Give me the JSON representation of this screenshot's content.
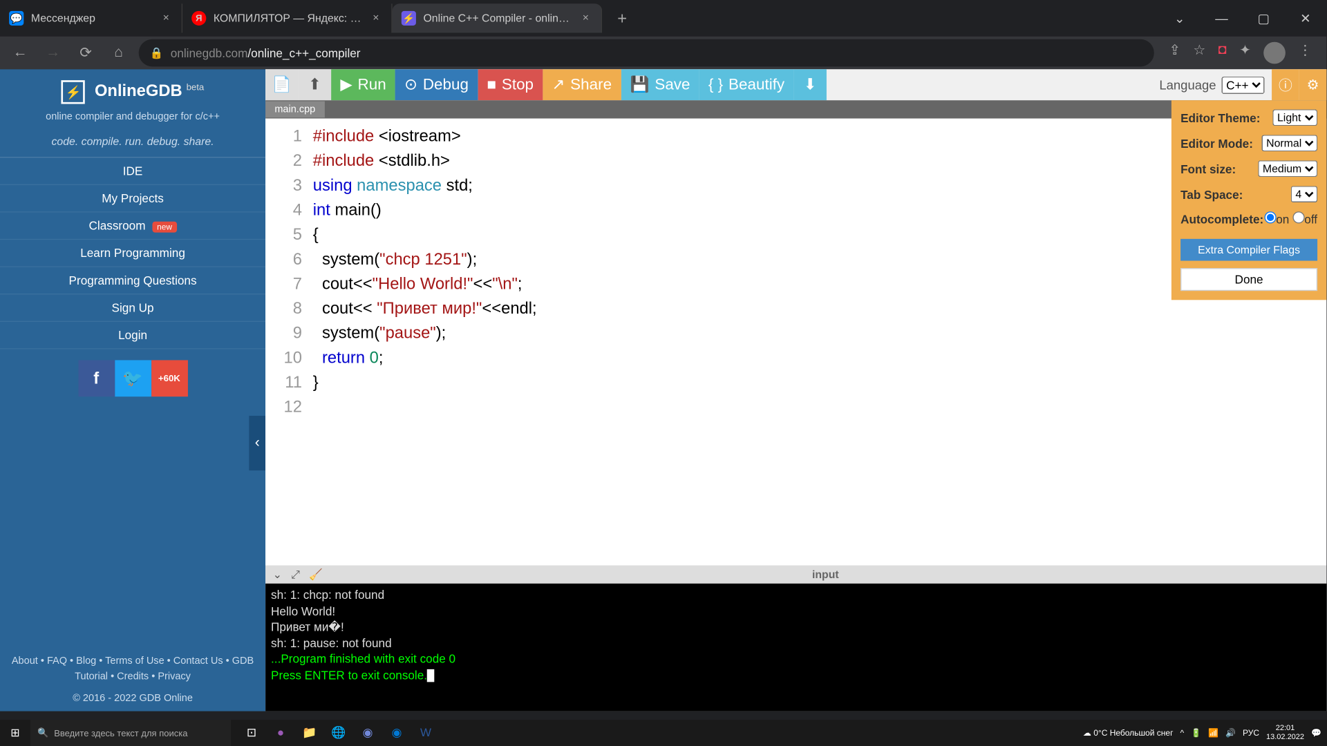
{
  "browser": {
    "tabs": [
      {
        "favicon": "💬",
        "title": "Мессенджер",
        "active": false
      },
      {
        "favicon": "Я",
        "title": "КОМПИЛЯТОР — Яндекс: нашл",
        "active": false
      },
      {
        "favicon": "⚡",
        "title": "Online C++ Compiler - online ed",
        "active": true
      }
    ],
    "url_host": "onlinegdb.com",
    "url_path": "/online_c++_compiler"
  },
  "sidebar": {
    "title": "OnlineGDB",
    "beta": "beta",
    "subtitle": "online compiler and debugger for c/c++",
    "slogan": "code. compile. run. debug. share.",
    "items": [
      "IDE",
      "My Projects",
      "Classroom",
      "Learn Programming",
      "Programming Questions",
      "Sign Up",
      "Login"
    ],
    "new_badge": "new",
    "social_count": "60K",
    "footer": "About • FAQ • Blog • Terms of Use • Contact Us • GDB Tutorial • Credits • Privacy",
    "copyright": "© 2016 - 2022 GDB Online"
  },
  "toolbar": {
    "run": "Run",
    "debug": "Debug",
    "stop": "Stop",
    "share": "Share",
    "save": "Save",
    "beautify": "Beautify",
    "lang_label": "Language",
    "lang_value": "C++"
  },
  "settings": {
    "theme_label": "Editor Theme:",
    "theme_value": "Light",
    "mode_label": "Editor Mode:",
    "mode_value": "Normal",
    "font_label": "Font size:",
    "font_value": "Medium",
    "tab_label": "Tab Space:",
    "tab_value": "4",
    "ac_label": "Autocomplete:",
    "ac_on": "on",
    "ac_off": "off",
    "flags": "Extra Compiler Flags",
    "done": "Done"
  },
  "editor": {
    "filename": "main.cpp",
    "lines": [
      "1",
      "2",
      "3",
      "4",
      "5",
      "6",
      "7",
      "8",
      "9",
      "10",
      "11",
      "12"
    ]
  },
  "code": {
    "l1_a": "#include",
    "l1_b": " <iostream>",
    "l2_a": "#include",
    "l2_b": " <stdlib.h>",
    "l3_a": "using",
    "l3_b": " namespace",
    "l3_c": " std;",
    "l4_a": "int",
    "l4_b": " main()",
    "l5": "{",
    "l6_a": "  system(",
    "l6_b": "\"chcp 1251\"",
    "l6_c": ");",
    "l7_a": "  cout<<",
    "l7_b": "\"Hello World!\"",
    "l7_c": "<<",
    "l7_d": "\"\\n\"",
    "l7_e": ";",
    "l8_a": "  cout<< ",
    "l8_b": "\"Привет мир!\"",
    "l8_c": "<<endl;",
    "l9_a": "  system(",
    "l9_b": "\"pause\"",
    "l9_c": ");",
    "l10_a": "  return ",
    "l10_b": "0",
    "l10_c": ";",
    "l11": "}",
    "l12": ""
  },
  "console": {
    "label": "input",
    "l1": "sh: 1: chcp: not found",
    "l2": "Hello World!",
    "l3": "Привет ми�!",
    "l4": "sh: 1: pause: not found",
    "l5": "",
    "l6": "...Program finished with exit code 0",
    "l7": "Press ENTER to exit console."
  },
  "taskbar": {
    "search_placeholder": "Введите здесь текст для поиска",
    "weather": "0°C  Небольшой снег",
    "lang": "РУС",
    "time": "22:01",
    "date": "13.02.2022"
  }
}
